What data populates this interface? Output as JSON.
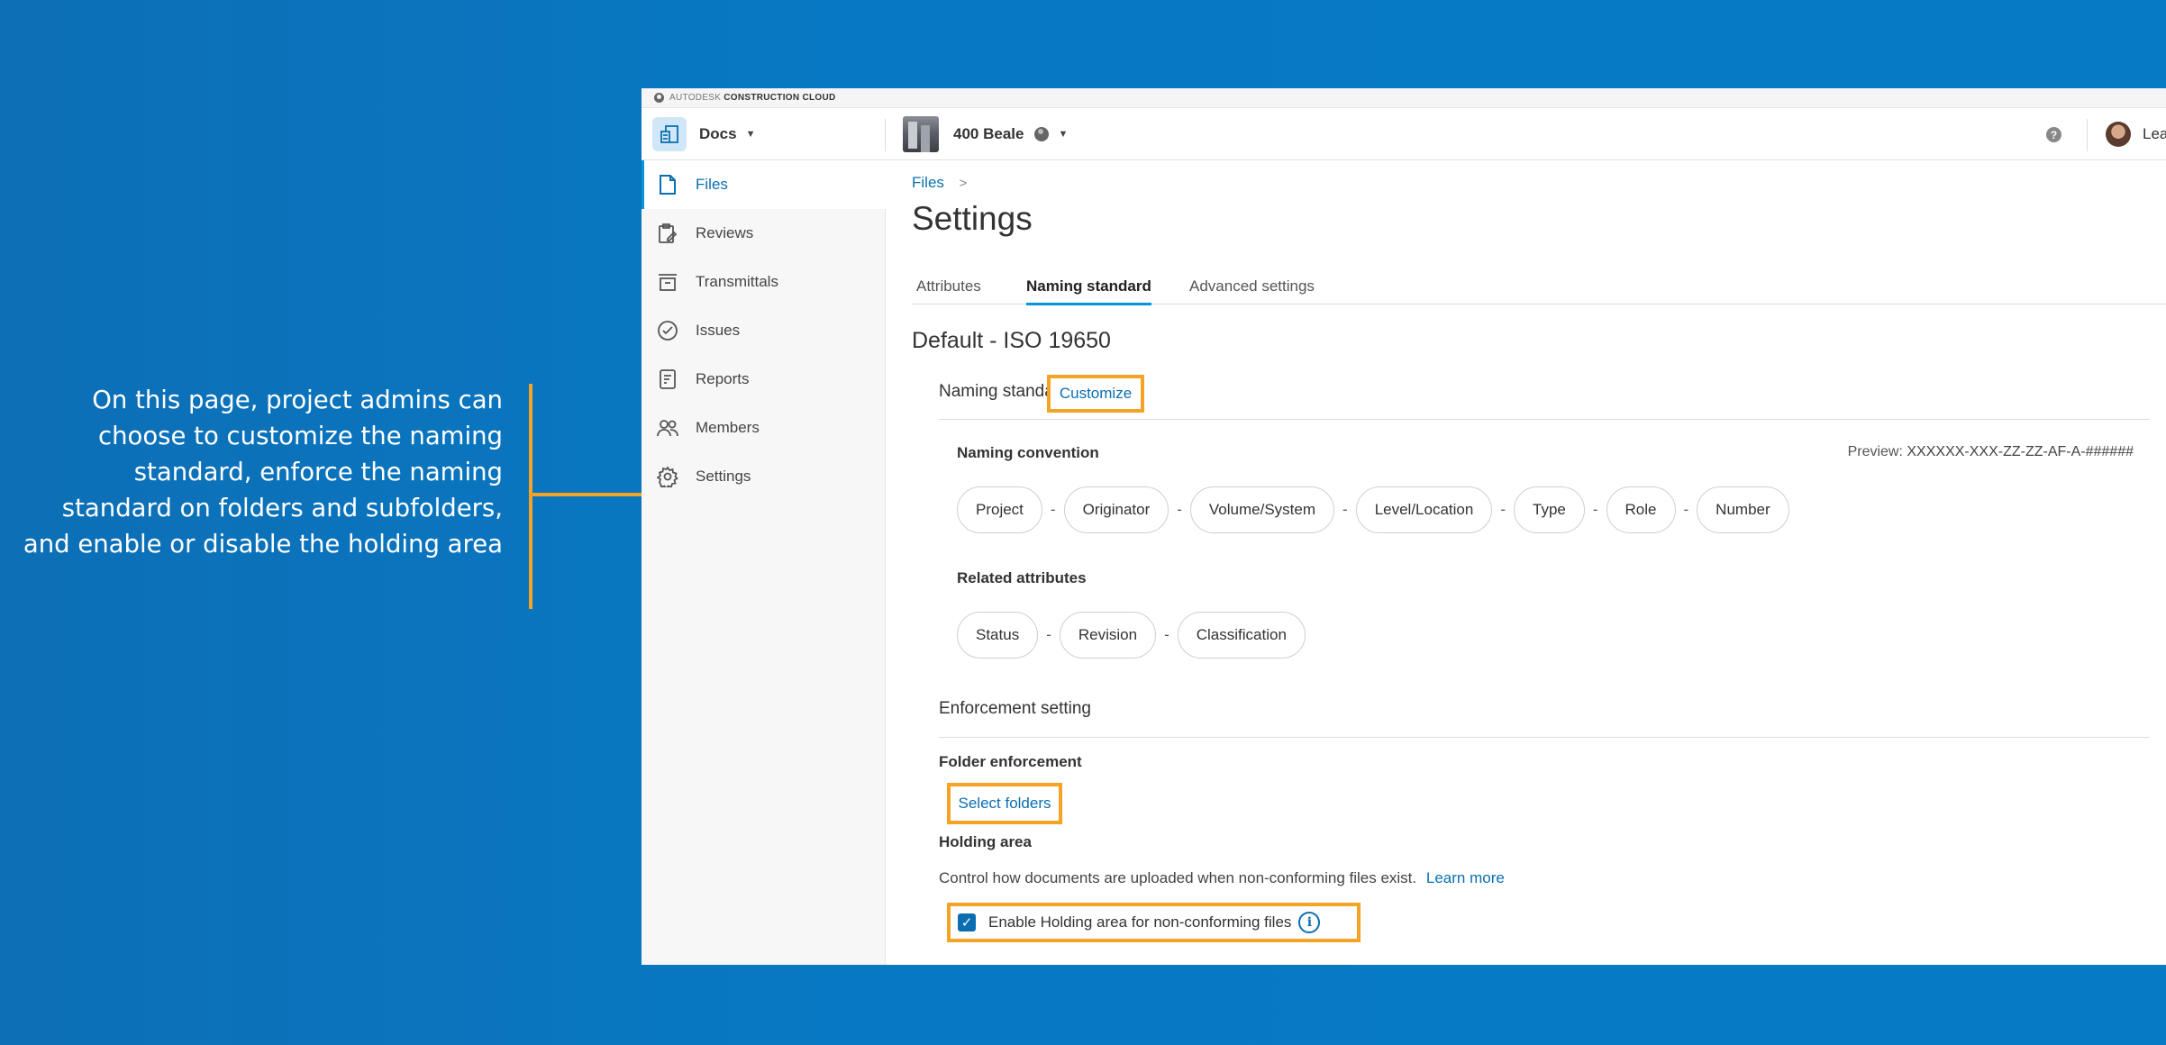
{
  "callout": {
    "lines": [
      "On this page, project admins can",
      "choose to customize the naming",
      "standard, enforce the naming",
      "standard on folders and subfolders,",
      "and enable or disable the holding area"
    ],
    "accent_color": "#f5a324"
  },
  "brand": {
    "part1": "AUTODESK",
    "part2": "CONSTRUCTION CLOUD"
  },
  "header": {
    "module_name": "Docs",
    "project_name": "400 Beale",
    "help_label": "?",
    "user_name": "Lea"
  },
  "sidebar": {
    "items": [
      {
        "label": "Files",
        "icon": "file-icon",
        "active": true
      },
      {
        "label": "Reviews",
        "icon": "reviews-icon",
        "active": false
      },
      {
        "label": "Transmittals",
        "icon": "transmittals-icon",
        "active": false
      },
      {
        "label": "Issues",
        "icon": "issues-icon",
        "active": false
      },
      {
        "label": "Reports",
        "icon": "reports-icon",
        "active": false
      },
      {
        "label": "Members",
        "icon": "members-icon",
        "active": false
      },
      {
        "label": "Settings",
        "icon": "gear-icon",
        "active": false
      }
    ],
    "collapse_glyph": "|←"
  },
  "main": {
    "breadcrumb": "Files",
    "breadcrumb_sep": ">",
    "title": "Settings",
    "tabs": [
      {
        "label": "Attributes",
        "active": false
      },
      {
        "label": "Naming standard",
        "active": true
      },
      {
        "label": "Advanced settings",
        "active": false
      }
    ],
    "section_title": "Default - ISO 19650",
    "naming_standard_label": "Naming standard",
    "customize_label": "Customize",
    "naming_convention_label": "Naming convention",
    "preview_prefix": "Preview:",
    "preview_value": "XXXXXX-XXX-ZZ-ZZ-AF-A-######",
    "convention_chips": [
      "Project",
      "Originator",
      "Volume/System",
      "Level/Location",
      "Type",
      "Role",
      "Number"
    ],
    "separator": "-",
    "related_attributes_label": "Related attributes",
    "related_chips": [
      "Status",
      "Revision",
      "Classification"
    ],
    "enforcement_heading": "Enforcement setting",
    "folder_enforcement_label": "Folder enforcement",
    "select_folders_label": "Select folders",
    "holding_area_label": "Holding area",
    "holding_description": "Control how documents are uploaded when non-conforming files exist.",
    "learn_more_label": "Learn more",
    "holding_checkbox_label": "Enable Holding area for non-conforming files",
    "holding_checkbox_checked": true,
    "info_glyph": "i",
    "check_glyph": "✓"
  },
  "colors": {
    "background": "#0779c4",
    "accent": "#0696d7",
    "link": "#0a6fb0",
    "highlight": "#f5a324"
  }
}
